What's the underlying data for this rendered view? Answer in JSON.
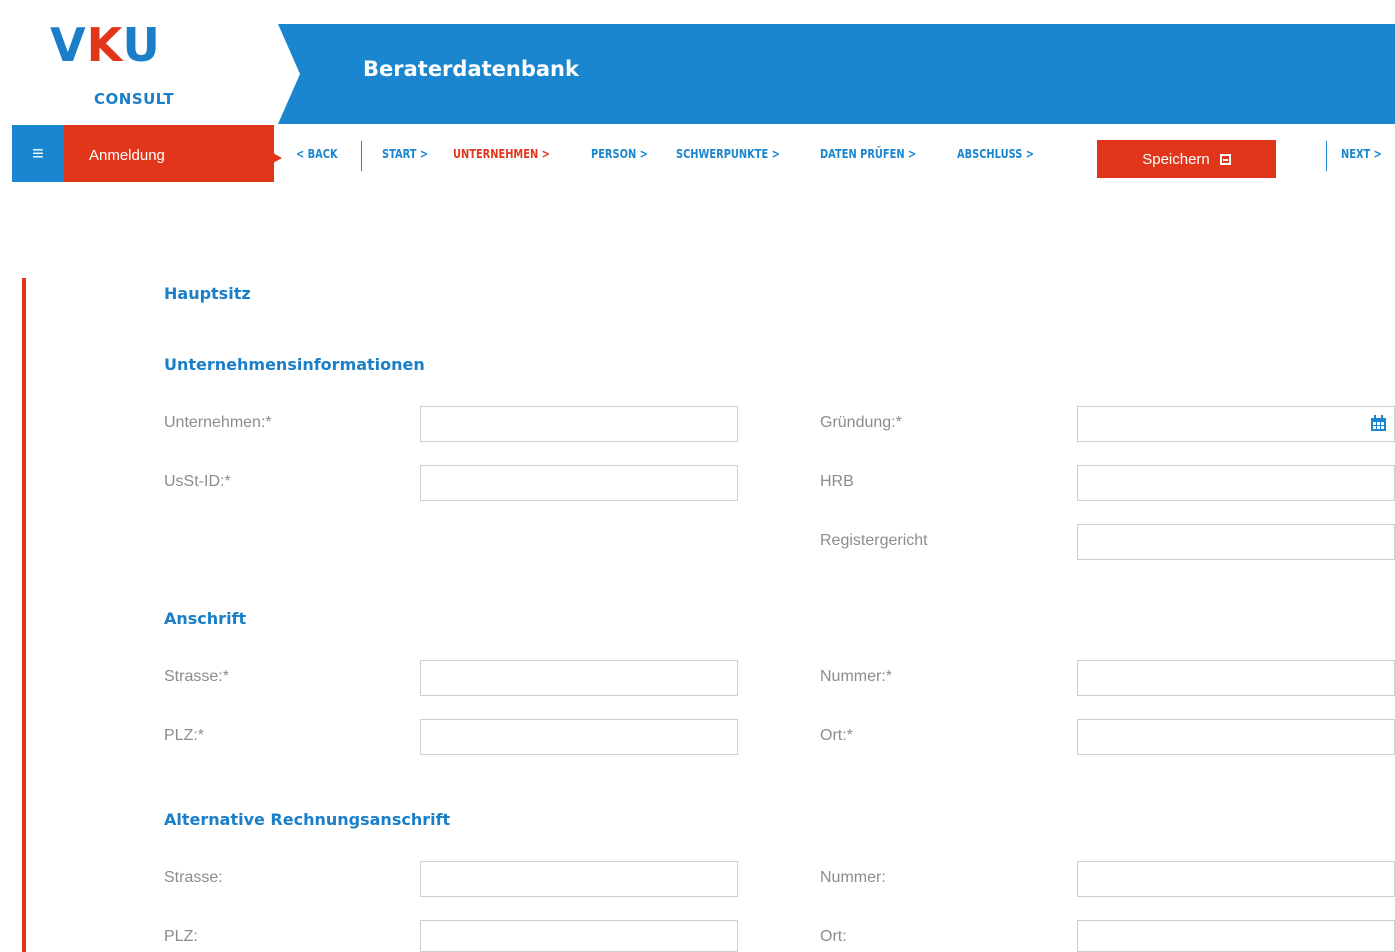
{
  "logo": {
    "mark_v": "V",
    "mark_k": "K",
    "mark_u": "U",
    "sub": "CONSULT"
  },
  "header": {
    "title": "Beraterdatenbank"
  },
  "sidebar": {
    "menu_icon": "hamburger-icon",
    "tab_label": "Anmeldung"
  },
  "nav": {
    "back": "< BACK",
    "steps": [
      "START >",
      "UNTERNEHMEN >",
      "PERSON >",
      "SCHWERPUNKTE >",
      "DATEN PRÜFEN >",
      "ABSCHLUSS >"
    ],
    "active_step": "UNTERNEHMEN >",
    "next": "NEXT >"
  },
  "save_button": {
    "label": "Speichern",
    "icon": "floppy-disk-icon"
  },
  "colors": {
    "blue": "#1a86d0",
    "red": "#e2361b",
    "label_gray": "#8c8c8c"
  },
  "form": {
    "page_heading": "Hauptsitz",
    "company": {
      "title": "Unternehmensinformationen",
      "unternehmen": {
        "label": "Unternehmen:*",
        "value": ""
      },
      "gruendung": {
        "label": "Gründung:*",
        "value": "",
        "icon": "calendar-icon"
      },
      "usst_id": {
        "label": "UsSt-ID:*",
        "value": ""
      },
      "hrb": {
        "label": "HRB",
        "value": ""
      },
      "registergericht": {
        "label": "Registergericht",
        "value": ""
      }
    },
    "address": {
      "title": "Anschrift",
      "strasse": {
        "label": "Strasse:*",
        "value": ""
      },
      "nummer": {
        "label": "Nummer:*",
        "value": ""
      },
      "plz": {
        "label": "PLZ:*",
        "value": ""
      },
      "ort": {
        "label": "Ort:*",
        "value": ""
      }
    },
    "billing": {
      "title": "Alternative Rechnungsanschrift",
      "strasse": {
        "label": "Strasse:",
        "value": ""
      },
      "nummer": {
        "label": "Nummer:",
        "value": ""
      },
      "plz": {
        "label": "PLZ:",
        "value": ""
      },
      "ort": {
        "label": "Ort:",
        "value": ""
      }
    }
  }
}
